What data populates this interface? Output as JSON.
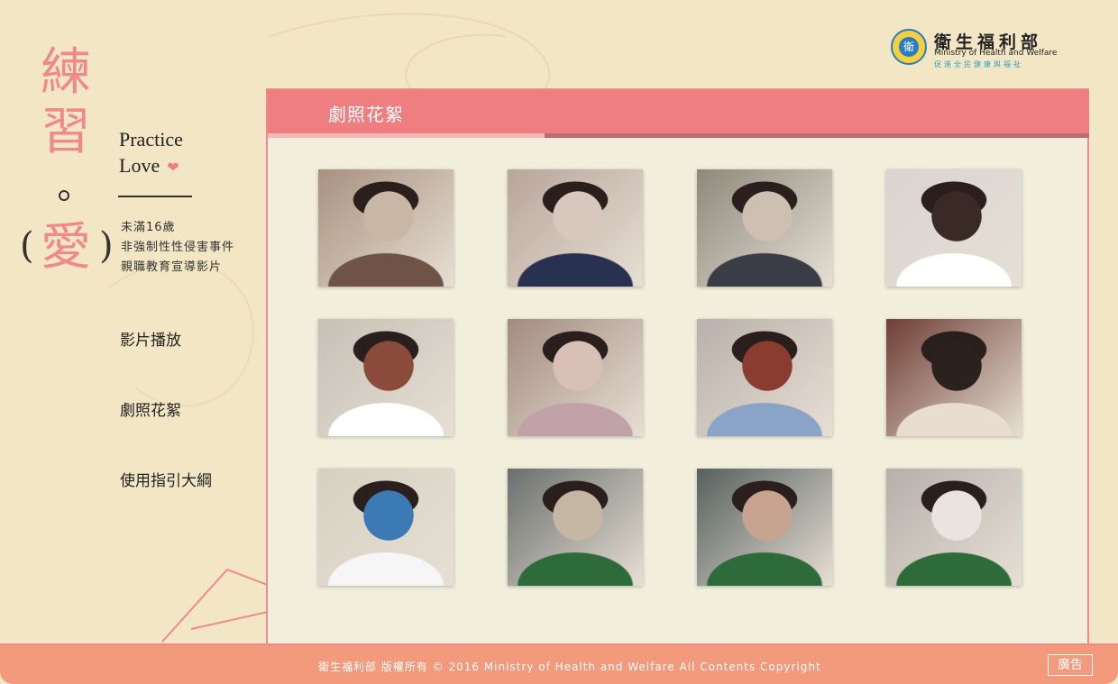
{
  "site": {
    "title_chars": [
      "練",
      "習",
      "愛"
    ],
    "paren_open": "(",
    "paren_close": ")",
    "practice_line1": "Practice",
    "practice_line2": "Love",
    "heart_icon": "heart-icon",
    "subtitle": [
      "未滿16歲",
      "非強制性性侵害事件",
      "親職教育宣導影片"
    ]
  },
  "logo": {
    "seal_icon": "ministry-seal-icon",
    "seal_text": "衛",
    "name_cn": "衛生福利部",
    "name_en": "Ministry of Health and Welfare",
    "slogan": "促進全民健康與福祉"
  },
  "nav": {
    "items": [
      {
        "label": "影片播放"
      },
      {
        "label": "劇照花絮"
      },
      {
        "label": "使用指引大綱"
      }
    ]
  },
  "panel": {
    "title": "劇照花絮",
    "photos": [
      {
        "desc": "man-plaid-shirt"
      },
      {
        "desc": "woman-navy-top"
      },
      {
        "desc": "couple-doorway"
      },
      {
        "desc": "girl-white-shirt-profile"
      },
      {
        "desc": "girl-white-shirt-seated"
      },
      {
        "desc": "woman-floral-top"
      },
      {
        "desc": "woman-striped-top"
      },
      {
        "desc": "woman-polka-dot-phone"
      },
      {
        "desc": "boy-smiling"
      },
      {
        "desc": "woman-apron-1"
      },
      {
        "desc": "woman-apron-2"
      },
      {
        "desc": "woman-apron-3"
      }
    ]
  },
  "footer": {
    "copyright": "衛生福利部 版權所有 © 2016 Ministry of Health and Welfare All Contents Copyright",
    "ad_label": "廣告"
  },
  "colors": {
    "background": "#f2e6c4",
    "accent_pink": "#ef7e80",
    "footer": "#f29a7b",
    "panel_bg": "#f1eedc"
  }
}
